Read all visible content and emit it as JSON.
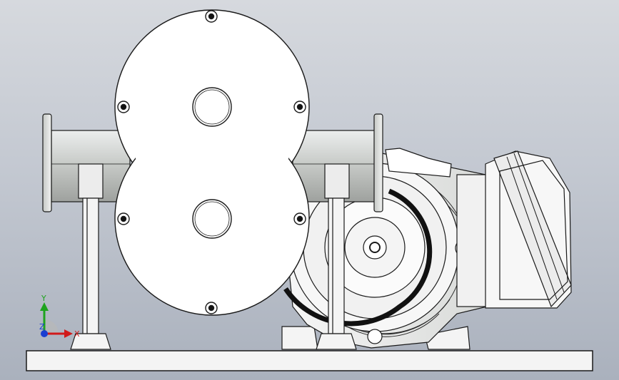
{
  "viewport": {
    "colors": {
      "background_top": "#d6d9de",
      "background_bottom": "#aab1bd",
      "part_fill": "#ffffff",
      "part_shade": "#d9dcdf",
      "edge": "#1a1a1a"
    }
  },
  "model": {
    "parts": [
      "base-plate",
      "pump-casing",
      "inlet-pipe",
      "outlet-pipe",
      "pipe-support-left",
      "pipe-support-right",
      "motor-body",
      "terminal-box"
    ]
  },
  "triad": {
    "x_label": "X",
    "y_label": "Y",
    "z_label": "Z",
    "colors": {
      "x": "#d11a1a",
      "y": "#1ea31e",
      "z": "#1a3fd1"
    }
  }
}
